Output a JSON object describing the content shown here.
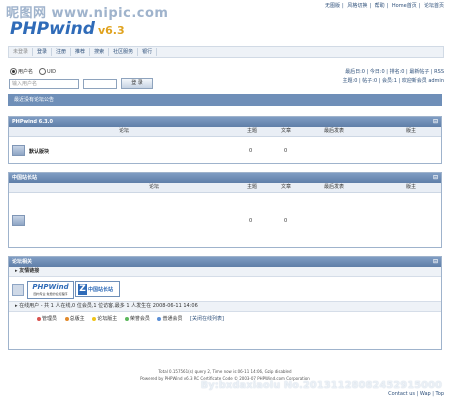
{
  "watermark_top": "昵图网 www.nipic.com",
  "watermark_bottom": "By:bxdaxiaolu  No.20131128082452915000",
  "top_links": [
    "无图版",
    "风格切换",
    "帮助",
    "Home首页",
    "论坛首页"
  ],
  "logo": {
    "name": "PHPwind",
    "version": "v6.3"
  },
  "nav": {
    "current": "未登录",
    "items": [
      "登录",
      "注册",
      "推荐",
      "搜索",
      "社区服务",
      "银行"
    ]
  },
  "login": {
    "radio_user": "用户名",
    "radio_uid": "UID",
    "username_placeholder": "输入用户名",
    "submit": "登 录",
    "status_line1": "最后日:0 | 今日:0 | 排名:0 | 最新帖子 | RSS",
    "status_line2": "主题:0 | 帖子:0 | 会员:1 | 欢迎新会员 admin"
  },
  "notice": "最近没有论坛公告",
  "section1": {
    "title": "PHPwind 6.3.0",
    "col_forum": "论坛",
    "col_topics": "主题",
    "col_posts": "文章",
    "col_last": "最后发表",
    "col_mod": "版主",
    "forum_name": "默认版块",
    "topics": "0",
    "posts": "0"
  },
  "section2": {
    "title": "中国站长站",
    "col_forum": "论坛",
    "col_topics": "主题",
    "col_posts": "文章",
    "col_last": "最后发表",
    "col_mod": "版主",
    "topics": "0",
    "posts": "0"
  },
  "section3": {
    "title": "论坛相关",
    "friend_links": "友情链接",
    "link1": "PHPWind",
    "link1_sub": "国内专业·免费的论坛程序",
    "link2": "中国站长站",
    "online_text": "在线用户 - 共 1 人在线,0 位会员,1 位访客,最多 1 人发生在 2008-06-11 14:06",
    "legend": [
      "管理员",
      "总版主",
      "论坛版主",
      "荣誉会员",
      "普通会员",
      "[关闭在线列表]"
    ]
  },
  "footer": {
    "line1": "Total 0.157561(s) query 2, Time now is:06-11 14:06, Gzip disabled",
    "line2": "Powered by PHPWind v6.3 RC Certificate Code © 2003-07 PHPWind.com Corporation",
    "right": "Contact us | Wap | Top"
  },
  "colors": {
    "accent": "#5f7ea8",
    "notice_bg": "#6f8fb8",
    "logo": "#2f6bb8",
    "version": "#e0a320"
  }
}
